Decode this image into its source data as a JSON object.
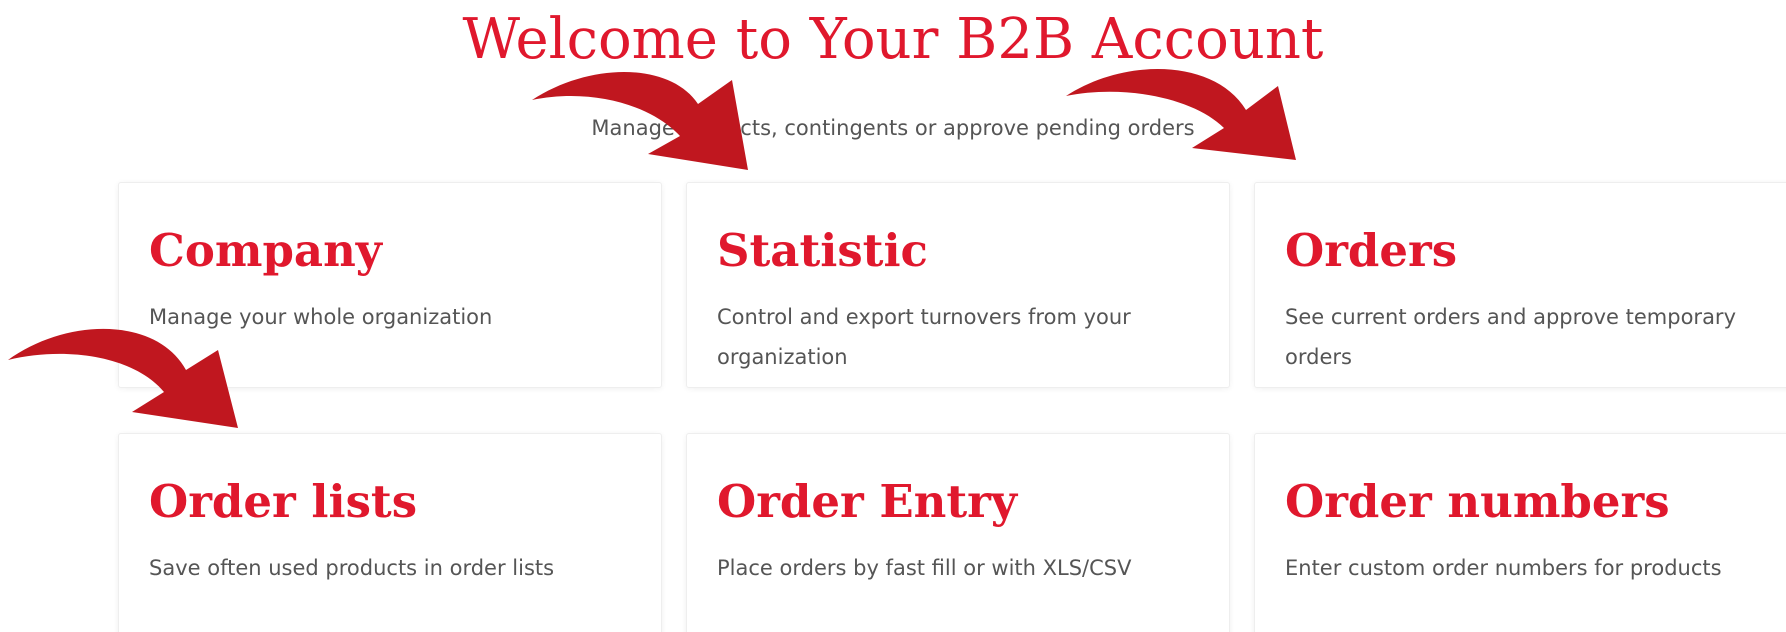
{
  "header": {
    "title": "Welcome to Your B2B Account",
    "subtitle": "Manage contacts, contingents or approve pending orders"
  },
  "cards": [
    {
      "title": "Company",
      "description": "Manage your whole organization"
    },
    {
      "title": "Statistic",
      "description": "Control and export turnovers from your organization"
    },
    {
      "title": "Orders",
      "description": "See current orders and approve temporary orders"
    },
    {
      "title": "Order lists",
      "description": "Save often used products in order lists"
    },
    {
      "title": "Order Entry",
      "description": "Place orders by fast fill or with XLS/CSV"
    },
    {
      "title": "Order numbers",
      "description": "Enter custom order numbers for products"
    }
  ],
  "colors": {
    "accent": "#e0182d",
    "arrow": "#c0171f",
    "text": "#555555"
  }
}
